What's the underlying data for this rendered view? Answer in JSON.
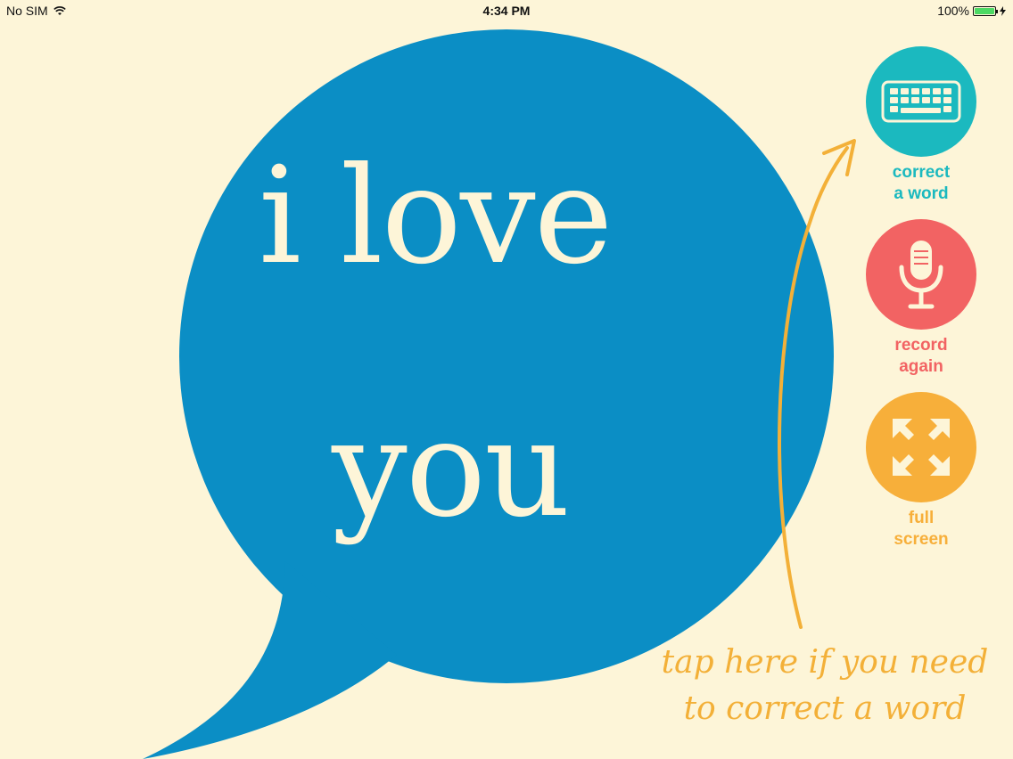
{
  "status_bar": {
    "carrier": "No SIM",
    "time": "4:34 PM",
    "battery": "100%",
    "wifi_icon": "wifi-icon",
    "battery_icon": "battery-icon",
    "charging_icon": "charging-bolt-icon"
  },
  "message": {
    "line1": "i love",
    "line2": "you",
    "bubble_color": "#0b8ec5",
    "text_color": "#fdf5d8"
  },
  "actions": {
    "correct": {
      "label_line1": "correct",
      "label_line2": "a word",
      "icon": "keyboard-icon",
      "color": "#1bb9bf"
    },
    "record": {
      "label_line1": "record",
      "label_line2": "again",
      "icon": "microphone-icon",
      "color": "#f26363"
    },
    "fullscreen": {
      "label_line1": "full",
      "label_line2": "screen",
      "icon": "expand-arrows-icon",
      "color": "#f7af3a"
    }
  },
  "hint": {
    "line1": "tap here if you need",
    "line2": "to correct a word",
    "color": "#f3b038"
  },
  "background": "#fdf5d8"
}
